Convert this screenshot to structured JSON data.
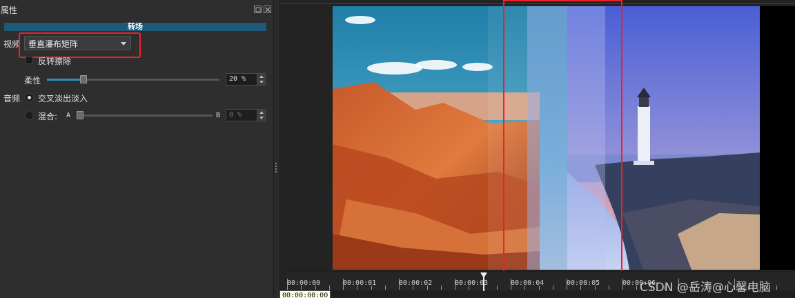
{
  "panel": {
    "title": "属性",
    "section": "转场",
    "video_label": "视频",
    "transition_type": "垂直瀑布矩阵",
    "reverse_wipe_label": "反转擦除",
    "softness_label": "柔性",
    "softness_value": "20 %",
    "softness_level": 0.2,
    "audio_label": "音频",
    "crossfade_label": "交叉淡出淡入",
    "mix_label": "混合:",
    "mix_a": "A",
    "mix_b": "B",
    "mix_value": "0 %"
  },
  "timeline": {
    "labels": [
      "00:00:00",
      "00:00:01",
      "00:00:02",
      "00:00:03",
      "00:00:04",
      "00:00:05",
      "00:00:06"
    ],
    "tooltip": "00:00:00:00"
  },
  "watermark": "CSDN @岳涛@心馨电脑",
  "colors": {
    "accent": "#2b8ec4",
    "section_bar": "#1e5a78",
    "highlight": "#e8232d"
  }
}
